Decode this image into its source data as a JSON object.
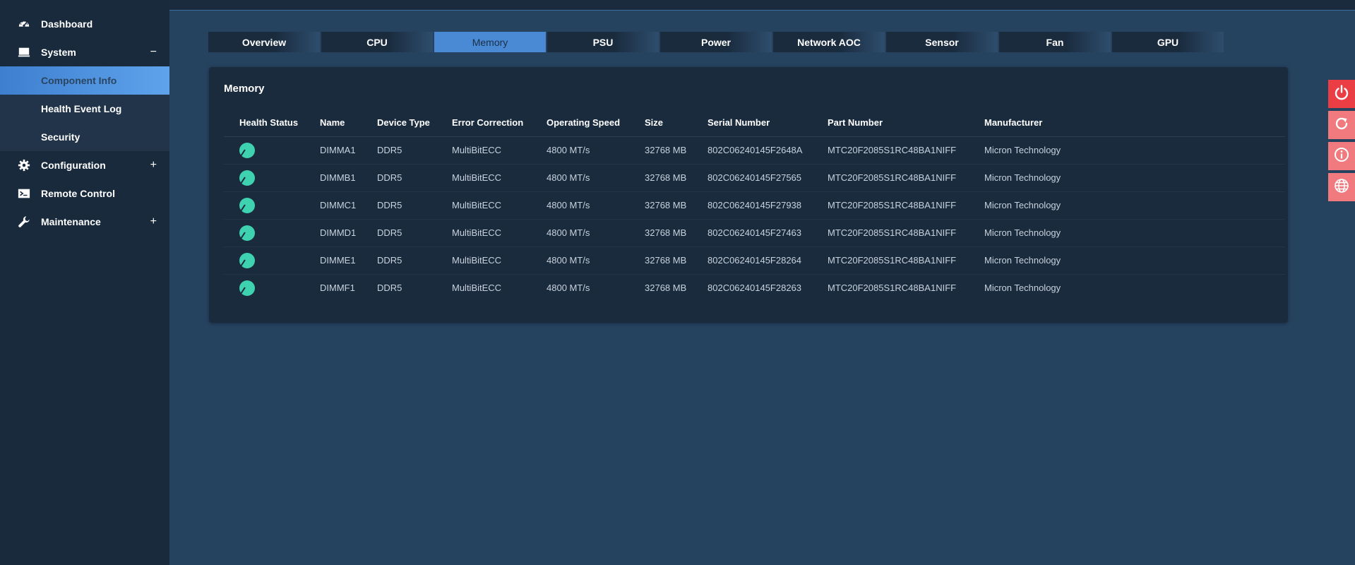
{
  "sidebar": {
    "dashboard": {
      "label": "Dashboard",
      "icon": "gauge-icon"
    },
    "system": {
      "label": "System",
      "toggle": "−",
      "icon": "monitor-icon",
      "children": [
        {
          "label": "Component Info",
          "active": true
        },
        {
          "label": "Health Event Log"
        },
        {
          "label": "Security"
        }
      ]
    },
    "configuration": {
      "label": "Configuration",
      "toggle": "+",
      "icon": "gear-icon"
    },
    "remote_control": {
      "label": "Remote Control",
      "icon": "terminal-icon"
    },
    "maintenance": {
      "label": "Maintenance",
      "toggle": "+",
      "icon": "wrench-icon"
    }
  },
  "tabs": [
    {
      "label": "Overview"
    },
    {
      "label": "CPU"
    },
    {
      "label": "Memory",
      "active": true
    },
    {
      "label": "PSU"
    },
    {
      "label": "Power"
    },
    {
      "label": "Network AOC"
    },
    {
      "label": "Sensor"
    },
    {
      "label": "Fan"
    },
    {
      "label": "GPU"
    }
  ],
  "panel": {
    "title": "Memory",
    "columns": [
      "Health Status",
      "Name",
      "Device Type",
      "Error Correction",
      "Operating Speed",
      "Size",
      "Serial Number",
      "Part Number",
      "Manufacturer"
    ],
    "rows": [
      {
        "health": "ok",
        "name": "DIMMA1",
        "device_type": "DDR5",
        "error_correction": "MultiBitECC",
        "speed": "4800 MT/s",
        "size": "32768 MB",
        "serial": "802C06240145F2648A",
        "part": "MTC20F2085S1RC48BA1NIFF",
        "manufacturer": "Micron Technology"
      },
      {
        "health": "ok",
        "name": "DIMMB1",
        "device_type": "DDR5",
        "error_correction": "MultiBitECC",
        "speed": "4800 MT/s",
        "size": "32768 MB",
        "serial": "802C06240145F27565",
        "part": "MTC20F2085S1RC48BA1NIFF",
        "manufacturer": "Micron Technology"
      },
      {
        "health": "ok",
        "name": "DIMMC1",
        "device_type": "DDR5",
        "error_correction": "MultiBitECC",
        "speed": "4800 MT/s",
        "size": "32768 MB",
        "serial": "802C06240145F27938",
        "part": "MTC20F2085S1RC48BA1NIFF",
        "manufacturer": "Micron Technology"
      },
      {
        "health": "ok",
        "name": "DIMMD1",
        "device_type": "DDR5",
        "error_correction": "MultiBitECC",
        "speed": "4800 MT/s",
        "size": "32768 MB",
        "serial": "802C06240145F27463",
        "part": "MTC20F2085S1RC48BA1NIFF",
        "manufacturer": "Micron Technology"
      },
      {
        "health": "ok",
        "name": "DIMME1",
        "device_type": "DDR5",
        "error_correction": "MultiBitECC",
        "speed": "4800 MT/s",
        "size": "32768 MB",
        "serial": "802C06240145F28264",
        "part": "MTC20F2085S1RC48BA1NIFF",
        "manufacturer": "Micron Technology"
      },
      {
        "health": "ok",
        "name": "DIMMF1",
        "device_type": "DDR5",
        "error_correction": "MultiBitECC",
        "speed": "4800 MT/s",
        "size": "32768 MB",
        "serial": "802C06240145F28263",
        "part": "MTC20F2085S1RC48BA1NIFF",
        "manufacturer": "Micron Technology"
      }
    ]
  },
  "actions": [
    {
      "icon": "power-icon",
      "color": "#ea3d44"
    },
    {
      "icon": "refresh-icon",
      "color": "#f07a7d"
    },
    {
      "icon": "info-icon",
      "color": "#f07a7d"
    },
    {
      "icon": "globe-icon",
      "color": "#f07a7d"
    }
  ],
  "colors": {
    "accent": "#4a8ad4",
    "health_ok": "#3fd2b0",
    "sidebar_bg": "#192a3d",
    "main_bg": "#25425f"
  }
}
